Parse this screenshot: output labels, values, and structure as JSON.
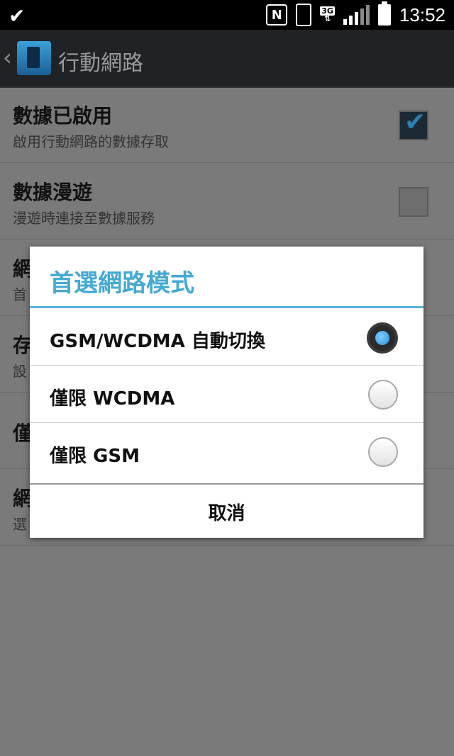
{
  "status_bar": {
    "time": "13:52",
    "network_type": "3G",
    "icons": [
      "check-icon",
      "nfc-icon",
      "vibrate-icon",
      "3g-data-icon",
      "signal-icon",
      "battery-icon"
    ]
  },
  "action_bar": {
    "title": "行動網路"
  },
  "settings": {
    "items": [
      {
        "title": "數據已啟用",
        "subtitle": "啟用行動網路的數據存取",
        "checked": true
      },
      {
        "title": "數據漫遊",
        "subtitle": "漫遊時連接至數據服務",
        "checked": false
      },
      {
        "title": "網",
        "subtitle": "首"
      },
      {
        "title": "存",
        "subtitle": "設"
      },
      {
        "title": "僅"
      },
      {
        "title": "網",
        "subtitle": "選"
      }
    ]
  },
  "dialog": {
    "title": "首選網路模式",
    "options": [
      {
        "label": "GSM/WCDMA 自動切換",
        "selected": true
      },
      {
        "label": "僅限 WCDMA",
        "selected": false
      },
      {
        "label": "僅限 GSM",
        "selected": false
      }
    ],
    "cancel_label": "取消"
  },
  "colors": {
    "accent": "#45a9d4",
    "dim_background": "#7a7a7a"
  }
}
